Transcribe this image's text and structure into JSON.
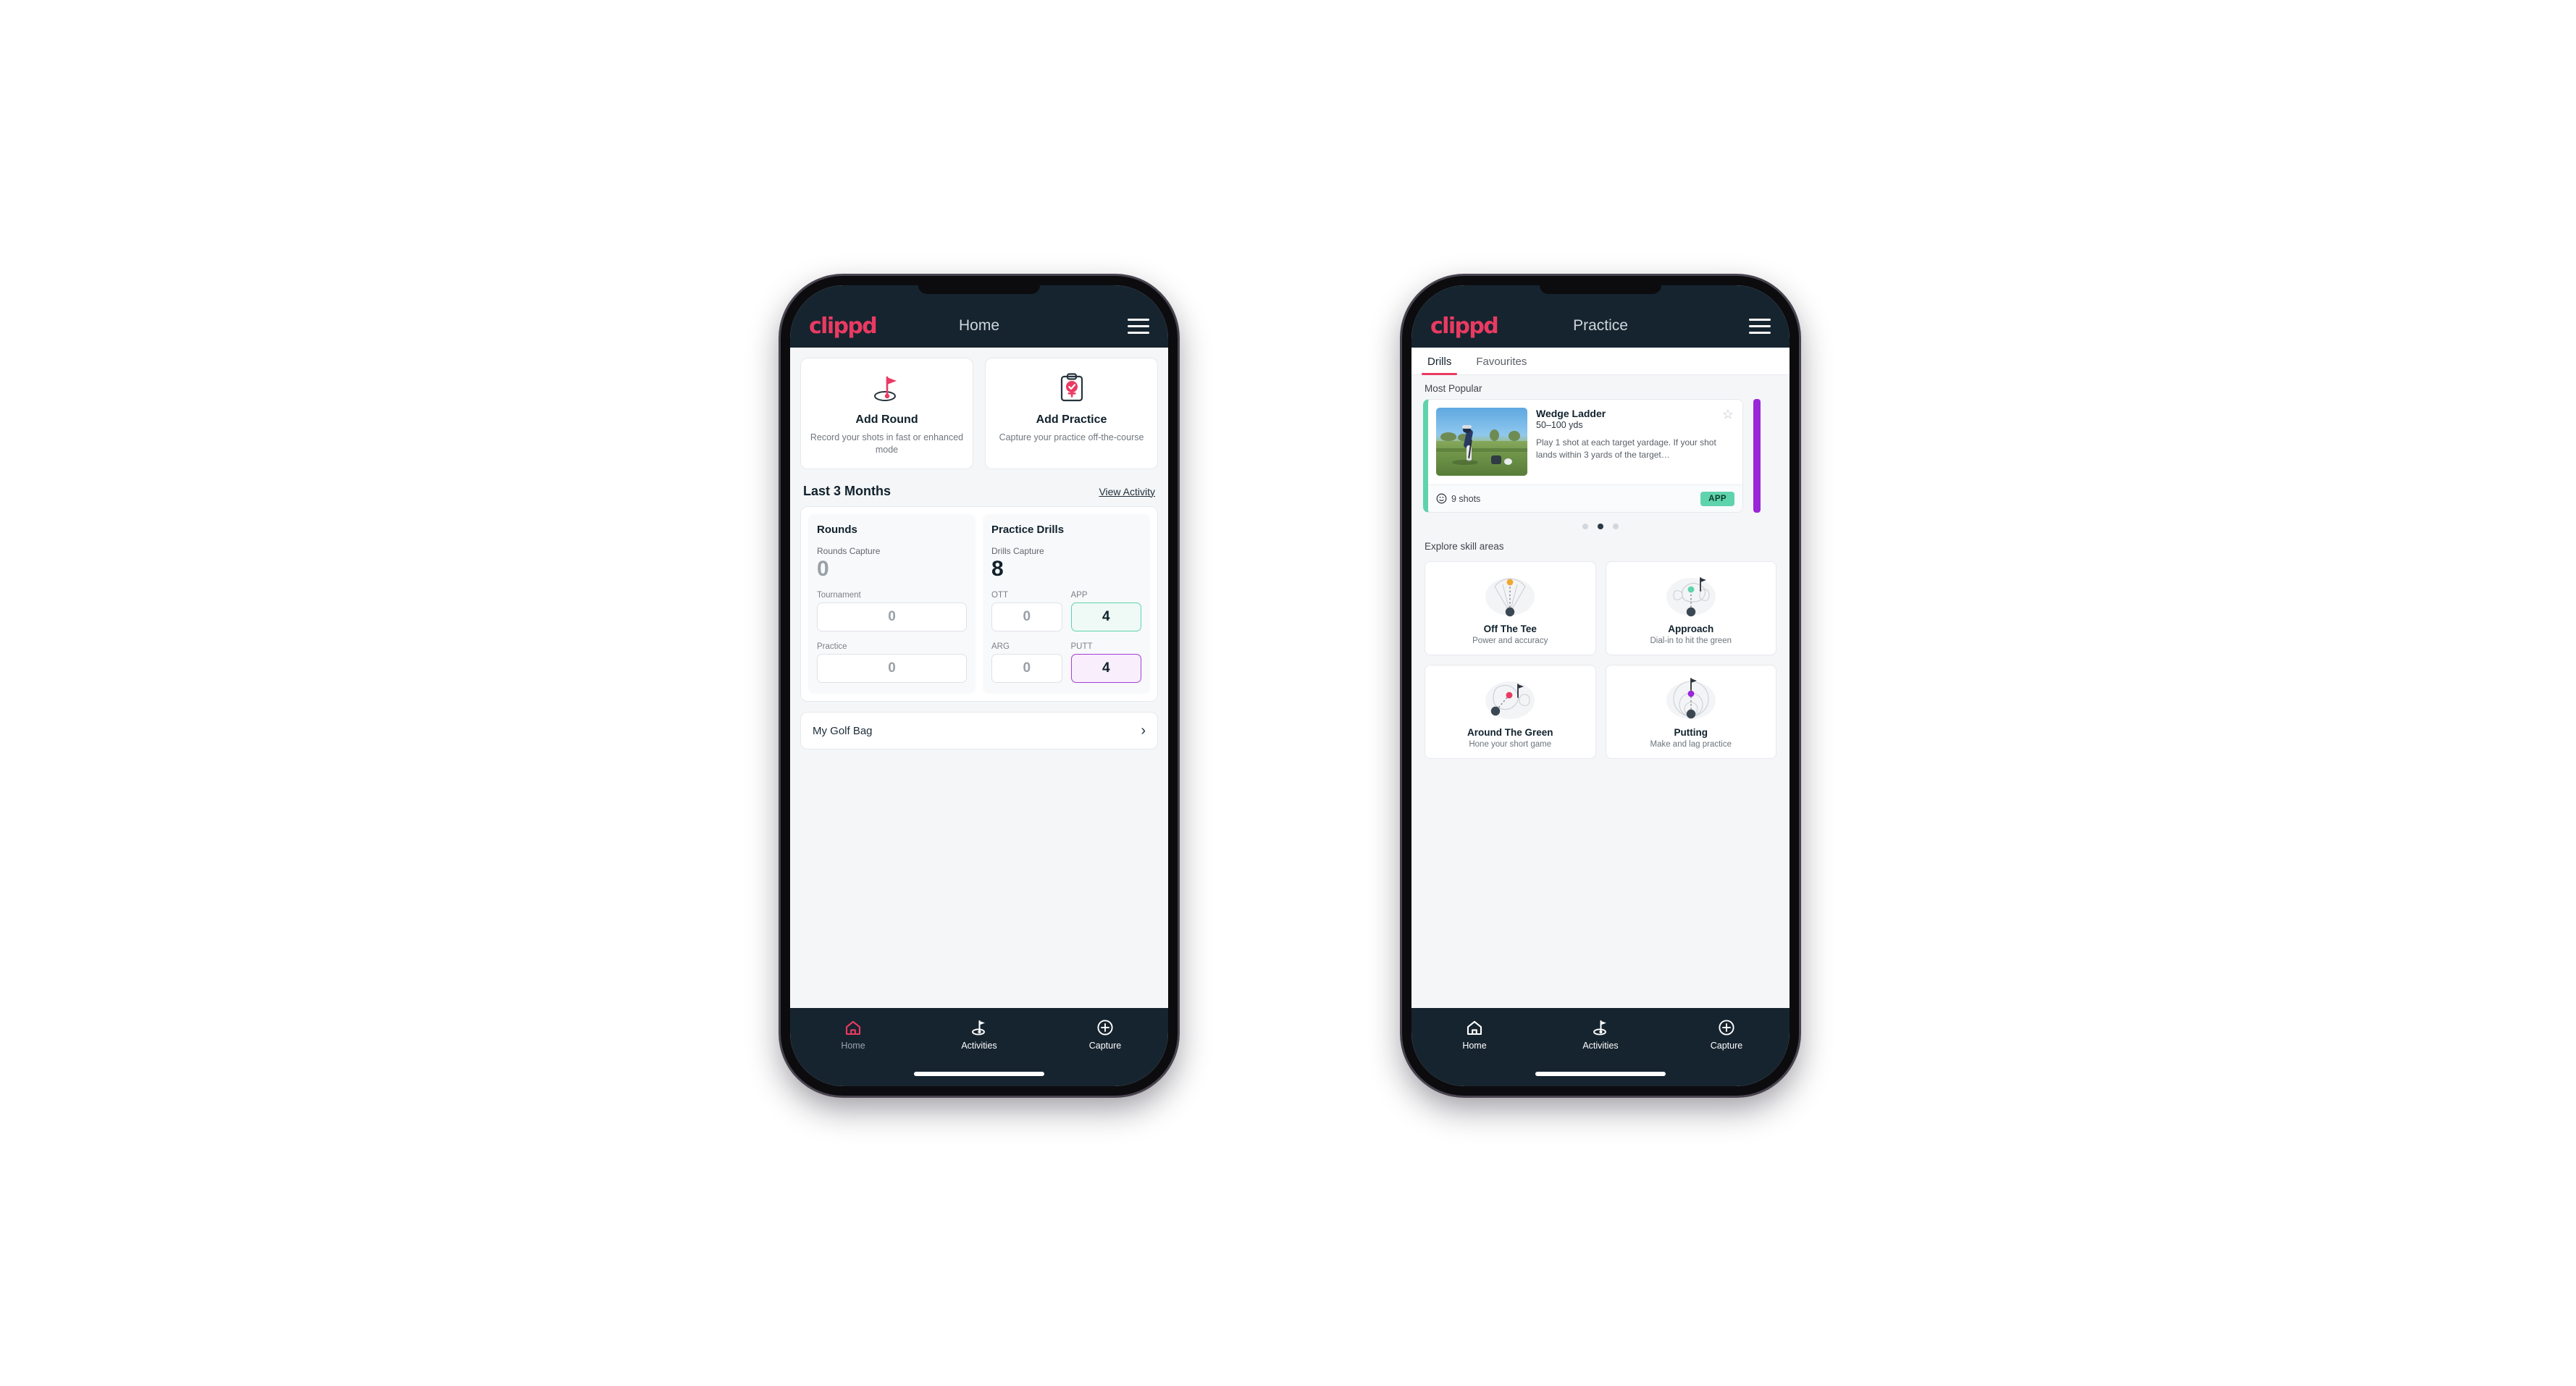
{
  "app": {
    "brand": "clippd",
    "accent": "#ea3a62",
    "header_bg": "#16242f"
  },
  "phone1": {
    "header": {
      "title": "Home",
      "menu_icon": "hamburger-menu-icon"
    },
    "quick_actions": [
      {
        "icon": "golf-flag-icon",
        "title": "Add Round",
        "subtitle": "Record your shots in fast or enhanced mode"
      },
      {
        "icon": "clipboard-check-icon",
        "title": "Add Practice",
        "subtitle": "Capture your practice off-the-course"
      }
    ],
    "section": {
      "title": "Last 3 Months",
      "link": "View Activity"
    },
    "stats": {
      "rounds": {
        "heading": "Rounds",
        "capture_label": "Rounds Capture",
        "capture_value": "0",
        "fields": [
          {
            "label": "Tournament",
            "value": "0",
            "highlight": "none"
          },
          {
            "label": "Practice",
            "value": "0",
            "highlight": "none"
          }
        ]
      },
      "drills": {
        "heading": "Practice Drills",
        "capture_label": "Drills Capture",
        "capture_value": "8",
        "fields": [
          {
            "label": "OTT",
            "value": "0",
            "highlight": "none"
          },
          {
            "label": "APP",
            "value": "4",
            "highlight": "green"
          },
          {
            "label": "ARG",
            "value": "0",
            "highlight": "none"
          },
          {
            "label": "PUTT",
            "value": "4",
            "highlight": "purple"
          }
        ]
      }
    },
    "golf_bag": {
      "label": "My Golf Bag",
      "chevron": "chevron-right-icon"
    },
    "bottom_nav": [
      {
        "icon": "home-icon",
        "label": "Home",
        "state": "active"
      },
      {
        "icon": "golf-flag-icon",
        "label": "Activities",
        "state": "default"
      },
      {
        "icon": "plus-circle-icon",
        "label": "Capture",
        "state": "default"
      }
    ]
  },
  "phone2": {
    "header": {
      "title": "Practice",
      "menu_icon": "hamburger-menu-icon"
    },
    "tabs": [
      {
        "label": "Drills",
        "active": true
      },
      {
        "label": "Favourites",
        "active": false
      }
    ],
    "most_popular": {
      "heading": "Most Popular"
    },
    "drill_card": {
      "title": "Wedge Ladder",
      "yardage": "50–100 yds",
      "description": "Play 1 shot at each target yardage. If your shot lands within 3 yards of the target…",
      "shots": "9 shots",
      "shots_icon": "clock-icon",
      "badge": "APP",
      "badge_color": "#5fd3ac",
      "accent_color": "#5fd3ac",
      "favourite_icon": "star-outline-icon",
      "thumbnail": "golfer-chipping-photo",
      "next_card_accent": "#9a27d8"
    },
    "carousel_dots": {
      "count": 3,
      "active_index": 1
    },
    "skill_section": {
      "heading": "Explore skill areas"
    },
    "skill_areas": [
      {
        "icon": "tee-shot-fan-icon",
        "name": "Off The Tee",
        "subtitle": "Power and accuracy",
        "dot_color": "#f0a830"
      },
      {
        "icon": "approach-green-icon",
        "name": "Approach",
        "subtitle": "Dial-in to hit the green",
        "dot_color": "#5fd3ac"
      },
      {
        "icon": "around-green-icon",
        "name": "Around The Green",
        "subtitle": "Hone your short game",
        "dot_color": "#ea3a62"
      },
      {
        "icon": "putting-rings-icon",
        "name": "Putting",
        "subtitle": "Make and lag practice",
        "dot_color": "#9a27d8"
      }
    ],
    "bottom_nav": [
      {
        "icon": "home-icon",
        "label": "Home",
        "state": "default"
      },
      {
        "icon": "golf-flag-icon",
        "label": "Activities",
        "state": "active"
      },
      {
        "icon": "plus-circle-icon",
        "label": "Capture",
        "state": "default"
      }
    ]
  }
}
